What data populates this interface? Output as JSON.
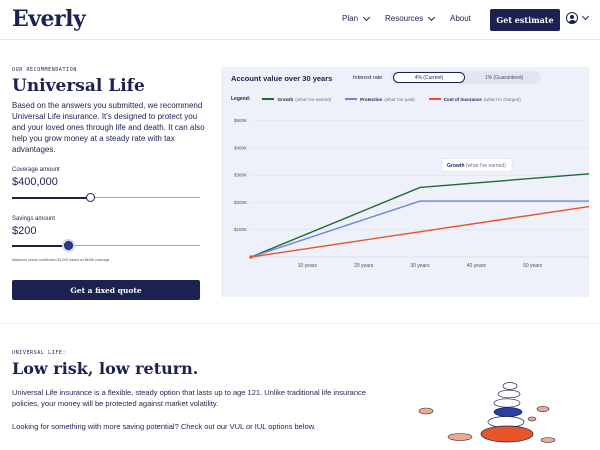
{
  "nav": {
    "logo": "Everly",
    "links": [
      {
        "label": "Plan",
        "has_dropdown": true
      },
      {
        "label": "Resources",
        "has_dropdown": true
      },
      {
        "label": "About",
        "has_dropdown": false
      }
    ],
    "cta_label": "Get estimate",
    "user_icon": "user-circle-icon"
  },
  "recommendation": {
    "eyebrow": "OUR RECOMMENDATION",
    "title": "Universal Life",
    "description": "Based on the answers you submitted, we recommend Universal Life insurance. It's designed to protect you and your loved ones through life and death. It can also help you grow money at a steady rate with tax advantages.",
    "coverage": {
      "label": "Coverage amount",
      "value": "$400,000",
      "level": 0.42
    },
    "savings": {
      "label": "Savings amount",
      "value": "$200",
      "level": 0.3
    },
    "note": "Maximum yearly contribution $1,000 based on $400k coverage",
    "button_label": "Get a fixed quote"
  },
  "chart_header": {
    "title": "Account value over 30 years",
    "rate_label": "Interest rate",
    "options": [
      "4% (Current)",
      "1% (Guaranteed)"
    ],
    "selected_option": "4% (Current)",
    "legend_title": "Legend:"
  },
  "chart_data": {
    "type": "line",
    "x_ticks": [
      "10 years",
      "20 years",
      "30 years",
      "40 years",
      "50 years"
    ],
    "y_ticks": [
      "$100K",
      "$200K",
      "$300K",
      "$400K",
      "$500K"
    ],
    "xlim": [
      0,
      60
    ],
    "ylim": [
      0,
      550
    ],
    "series": [
      {
        "name": "Growth",
        "note": "(what I've earned)",
        "color": "#1e6b2e",
        "x": [
          0,
          30,
          60
        ],
        "y": [
          0,
          255,
          305
        ]
      },
      {
        "name": "Protection",
        "note": "(what I've paid)",
        "color": "#6b87d9",
        "x": [
          0,
          30,
          60
        ],
        "y": [
          0,
          205,
          205
        ]
      },
      {
        "name": "Cost of insurance",
        "note": "(what I'm charged)",
        "color": "#e8552a",
        "x": [
          0,
          60
        ],
        "y": [
          0,
          185
        ]
      }
    ],
    "tooltip": {
      "label": "Growth",
      "note": "(what I've earned)"
    }
  },
  "universal": {
    "eyebrow": "UNIVERSAL LIFE:",
    "title": "Low risk, low return.",
    "paragraph1": "Universal Life insurance is a flexible, steady option that lasts up to age 121. Unlike traditional life insurance policies, your money will be protected against market volatility.",
    "paragraph2": "Looking for something with more saving potential? Check out our VUL or IUL options below."
  },
  "colors": {
    "brand": "#1b2150",
    "chart_bg": "#eef0fa"
  }
}
